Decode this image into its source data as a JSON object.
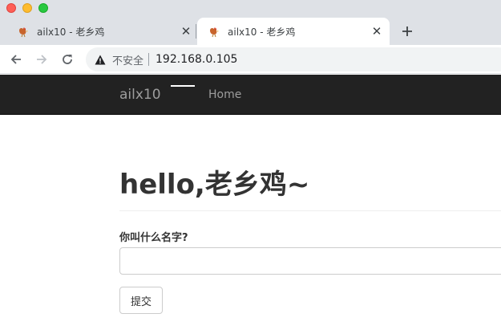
{
  "window": {
    "controls": [
      "close",
      "minimize",
      "zoom"
    ]
  },
  "tabs": [
    {
      "title": "ailx10 - 老乡鸡",
      "favicon": "rooster-icon",
      "active": false
    },
    {
      "title": "ailx10 - 老乡鸡",
      "favicon": "rooster-icon",
      "active": true
    }
  ],
  "toolbar": {
    "security_label": "不安全",
    "url": "192.168.0.105"
  },
  "navbar": {
    "brand": "ailx10",
    "home_label": "Home"
  },
  "main": {
    "heading": "hello,老乡鸡~",
    "form": {
      "name_label": "你叫什么名字?",
      "name_value": "",
      "submit_label": "提交"
    }
  },
  "colors": {
    "navbar_bg": "#222222",
    "navbar_text": "#9d9d9d",
    "heading_text": "#333333",
    "chrome_bg": "#dee1e6"
  }
}
